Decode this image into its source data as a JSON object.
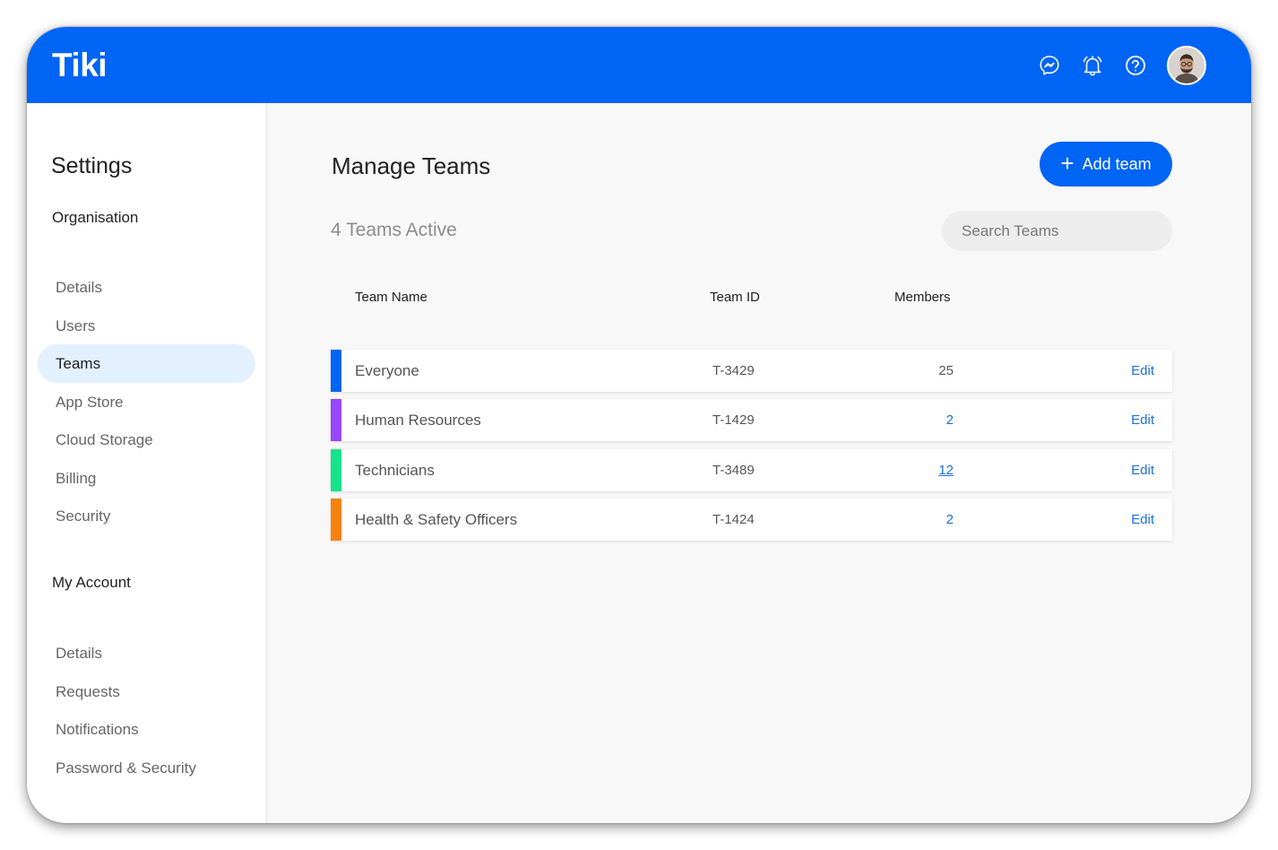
{
  "header": {
    "logo": "Tiki",
    "icons": [
      "messenger-icon",
      "bell-icon",
      "help-icon"
    ],
    "brand_color": "#0064f5"
  },
  "sidebar": {
    "title": "Settings",
    "organisation": {
      "title": "Organisation",
      "items": [
        {
          "label": "Details"
        },
        {
          "label": "Users"
        },
        {
          "label": "Teams",
          "active": true
        },
        {
          "label": "App Store"
        },
        {
          "label": "Cloud Storage"
        },
        {
          "label": "Billing"
        },
        {
          "label": "Security"
        }
      ]
    },
    "account": {
      "title": "My Account",
      "items": [
        {
          "label": "Details"
        },
        {
          "label": "Requests"
        },
        {
          "label": "Notifications"
        },
        {
          "label": "Password & Security"
        }
      ]
    }
  },
  "main": {
    "title": "Manage Teams",
    "add_button": "Add team",
    "active_count": "4 Teams Active",
    "search_placeholder": "Search Teams",
    "columns": {
      "name": "Team Name",
      "id": "Team ID",
      "members": "Members"
    },
    "teams": [
      {
        "name": "Everyone",
        "id": "T-3429",
        "members": "25",
        "color": "#0064f5",
        "edit": "Edit"
      },
      {
        "name": "Human Resources",
        "id": "T-1429",
        "members": "2",
        "color": "#9747ff",
        "edit": "Edit"
      },
      {
        "name": "Technicians",
        "id": "T-3489",
        "members": "12",
        "color": "#14e38a",
        "edit": "Edit"
      },
      {
        "name": "Health & Safety Officers",
        "id": "T-1424",
        "members": "2",
        "color": "#f5820f",
        "edit": "Edit"
      }
    ]
  }
}
